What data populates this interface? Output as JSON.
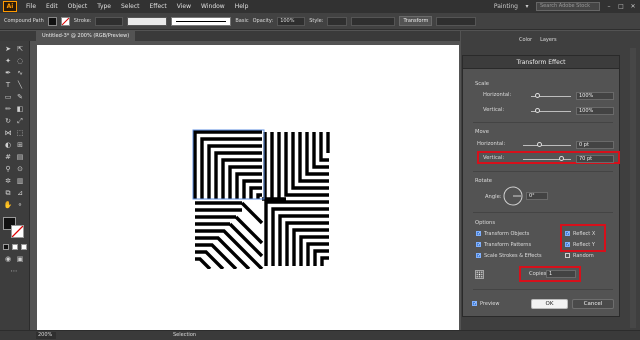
{
  "app": {
    "logo": "Ai",
    "workspace": "Painting",
    "search_placeholder": "Search Adobe Stock"
  },
  "menu": [
    "File",
    "Edit",
    "Object",
    "Type",
    "Select",
    "Effect",
    "View",
    "Window",
    "Help"
  ],
  "control_bar": {
    "selection_label": "Compound Path",
    "stroke_label": "Stroke:",
    "brush_label": "Basic",
    "opacity_label": "Opacity:",
    "opacity_value": "100%",
    "style_label": "Style:",
    "transform_label": "Transform"
  },
  "document_tab": "Untitled-3* @ 200% (RGB/Preview)",
  "panel_tabs": [
    "Color",
    "Layers"
  ],
  "dialog": {
    "title": "Transform Effect",
    "scale": {
      "label": "Scale",
      "horizontal_label": "Horizontal:",
      "horizontal_value": "100%",
      "vertical_label": "Vertical:",
      "vertical_value": "100%"
    },
    "move": {
      "label": "Move",
      "horizontal_label": "Horizontal:",
      "horizontal_value": "0 pt",
      "vertical_label": "Vertical:",
      "vertical_value": "70 pt"
    },
    "rotate": {
      "label": "Rotate",
      "angle_label": "Angle:",
      "angle_value": "0°"
    },
    "options": {
      "label": "Options",
      "transform_objects": "Transform Objects",
      "transform_patterns": "Transform Patterns",
      "scale_strokes": "Scale Strokes & Effects",
      "reflect_x": "Reflect X",
      "reflect_y": "Reflect Y",
      "random": "Random"
    },
    "copies_label": "Copies",
    "copies_value": "1",
    "preview_label": "Preview",
    "ok_label": "OK",
    "cancel_label": "Cancel"
  },
  "status_bar": {
    "zoom": "200%",
    "mode": "Selection"
  },
  "colors": {
    "accent": "#3d7bd8",
    "highlight": "#d6101b",
    "selection": "#5f8fe0"
  }
}
